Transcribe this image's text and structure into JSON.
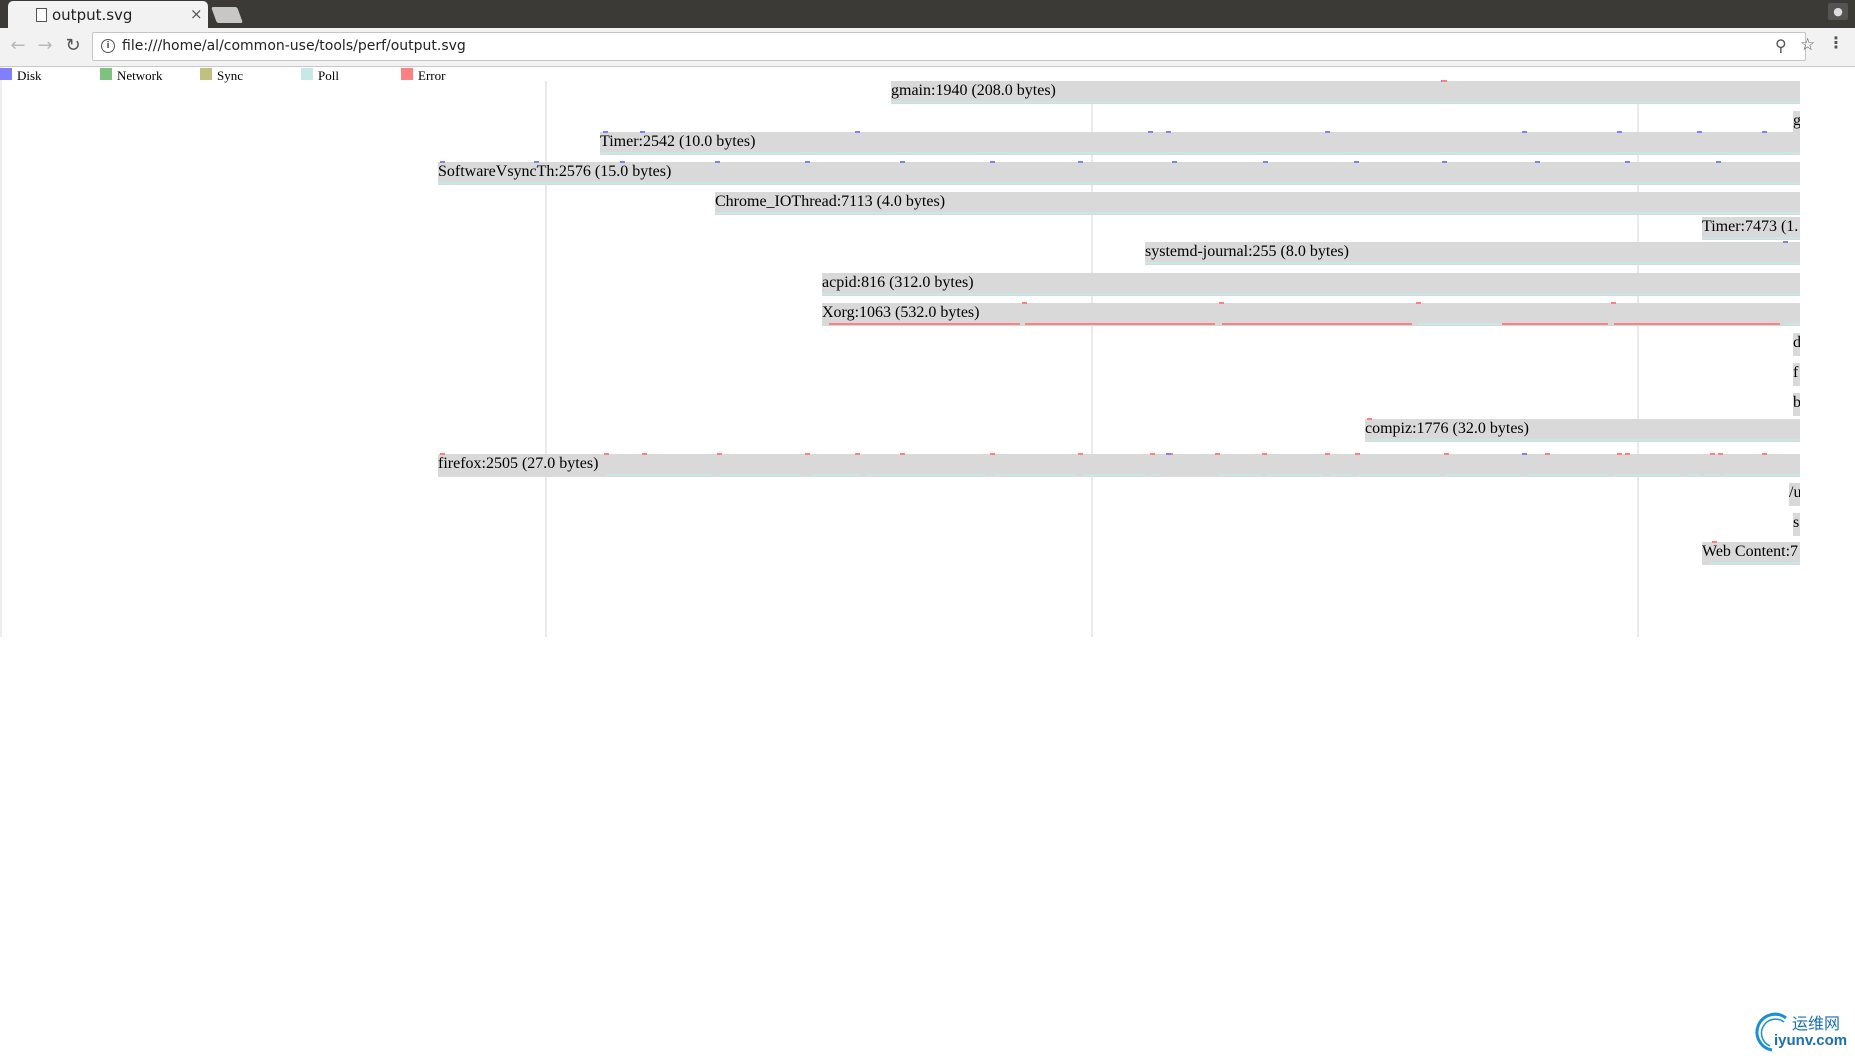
{
  "browser": {
    "tab_title": "output.svg",
    "tab_close": "×",
    "url": "file:///home/al/common-use/tools/perf/output.svg",
    "icons": [
      "page-icon",
      "close-icon",
      "back-icon",
      "forward-icon",
      "reload-icon",
      "info-icon",
      "zoom-icon",
      "star-icon",
      "menu-icon",
      "profile-icon"
    ]
  },
  "legend": [
    {
      "label": "Disk",
      "color": "#8080ff"
    },
    {
      "label": "Network",
      "color": "#80c080"
    },
    {
      "label": "Sync",
      "color": "#c0c080"
    },
    {
      "label": "Poll",
      "color": "#c8e8e8"
    },
    {
      "label": "Error",
      "color": "#ff8080"
    }
  ],
  "processes": [
    {
      "label": "gmain:1940 (208.0 bytes)"
    },
    {
      "label": "g"
    },
    {
      "label": "Timer:2542 (10.0 bytes)"
    },
    {
      "label": "SoftwareVsyncTh:2576 (15.0 bytes)"
    },
    {
      "label": "Chrome_IOThread:7113 (4.0 bytes)"
    },
    {
      "label": "Timer:7473 (1."
    },
    {
      "label": "systemd-journal:255 (8.0 bytes)"
    },
    {
      "label": "acpid:816 (312.0 bytes)"
    },
    {
      "label": "Xorg:1063 (532.0 bytes)"
    },
    {
      "label": "d"
    },
    {
      "label": "f"
    },
    {
      "label": "b"
    },
    {
      "label": "compiz:1776 (32.0 bytes)"
    },
    {
      "label": "firefox:2505 (27.0 bytes)"
    },
    {
      "label": "/u"
    },
    {
      "label": "s"
    },
    {
      "label": "Web Content:7"
    }
  ],
  "watermark": {
    "cn": "运维网",
    "en": "iyunv.com"
  }
}
